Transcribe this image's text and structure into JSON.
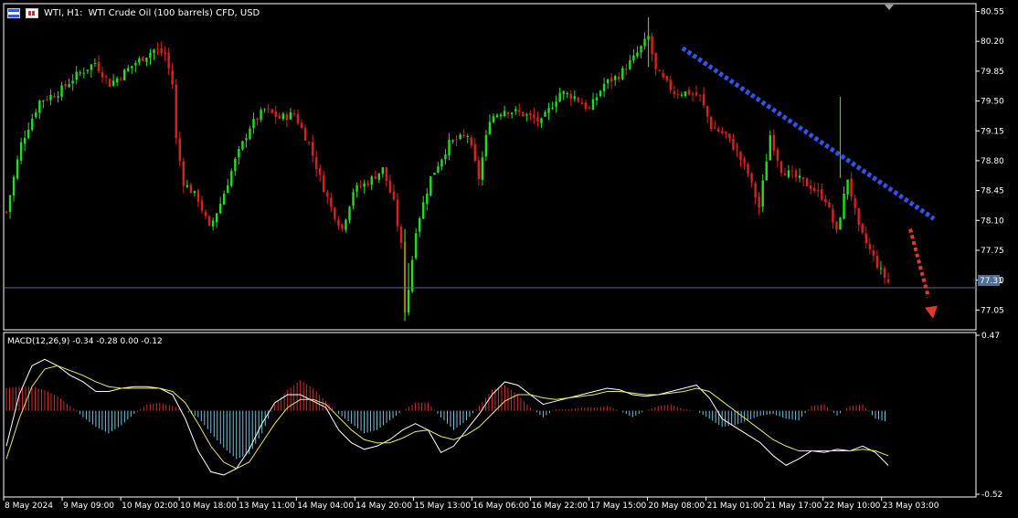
{
  "header": {
    "symbol": "WTI, H1:",
    "description": "WTI Crude Oil (100 barrels) CFD, USD"
  },
  "macd_label": "MACD(12,26,9) -0.34 -0.28 0.00 -0.12",
  "current_price_label": "77.31",
  "colors": {
    "bull": "#22dd22",
    "bear": "#dd1f1f",
    "macd_hist_pos": "#d42a2a",
    "macd_hist_neg": "#6fc6de",
    "signal": "#e8e868",
    "trendline": "#3355ee",
    "forecast_arrow": "#e0392f",
    "price_line": "#4e6f93"
  },
  "chart_data": [
    {
      "type": "candlestick",
      "title": "WTI, H1: WTI Crude Oil (100 barrels) CFD, USD",
      "ylim": [
        76.85,
        80.62
      ],
      "y_ticks": [
        "80.55",
        "80.20",
        "79.85",
        "79.50",
        "79.15",
        "78.80",
        "78.45",
        "78.10",
        "77.75",
        "77.40",
        "77.05"
      ],
      "x_ticks": [
        "8 May 2024",
        "9 May 09:00",
        "10 May 02:00",
        "10 May 18:00",
        "13 May 11:00",
        "14 May 04:00",
        "14 May 20:00",
        "15 May 13:00",
        "16 May 06:00",
        "16 May 22:00",
        "17 May 15:00",
        "20 May 08:00",
        "21 May 01:00",
        "21 May 17:00",
        "22 May 10:00",
        "23 May 03:00"
      ],
      "close_path_approx": [
        [
          0,
          78.2
        ],
        [
          4,
          79.0
        ],
        [
          9,
          79.5
        ],
        [
          14,
          79.6
        ],
        [
          19,
          79.8
        ],
        [
          24,
          79.95
        ],
        [
          28,
          79.7
        ],
        [
          31,
          79.8
        ],
        [
          35,
          79.95
        ],
        [
          40,
          80.1
        ],
        [
          43,
          80.05
        ],
        [
          45,
          79.7
        ],
        [
          46,
          79.05
        ],
        [
          48,
          78.55
        ],
        [
          52,
          78.35
        ],
        [
          55,
          78.0
        ],
        [
          58,
          78.3
        ],
        [
          62,
          78.8
        ],
        [
          66,
          79.2
        ],
        [
          70,
          79.4
        ],
        [
          74,
          79.3
        ],
        [
          78,
          79.35
        ],
        [
          82,
          79.0
        ],
        [
          85,
          78.6
        ],
        [
          88,
          78.25
        ],
        [
          91,
          78.0
        ],
        [
          94,
          78.45
        ],
        [
          98,
          78.55
        ],
        [
          102,
          78.7
        ],
        [
          105,
          78.3
        ],
        [
          107,
          77.8
        ],
        [
          108,
          77.05
        ],
        [
          109,
          77.3
        ],
        [
          111,
          78.0
        ],
        [
          115,
          78.6
        ],
        [
          120,
          79.0
        ],
        [
          125,
          79.1
        ],
        [
          128,
          78.6
        ],
        [
          131,
          79.3
        ],
        [
          135,
          79.4
        ],
        [
          140,
          79.35
        ],
        [
          145,
          79.25
        ],
        [
          150,
          79.6
        ],
        [
          154,
          79.55
        ],
        [
          158,
          79.4
        ],
        [
          162,
          79.7
        ],
        [
          166,
          79.8
        ],
        [
          170,
          80.0
        ],
        [
          174,
          80.25
        ],
        [
          176,
          79.85
        ],
        [
          178,
          79.75
        ],
        [
          181,
          79.6
        ],
        [
          185,
          79.6
        ],
        [
          188,
          79.55
        ],
        [
          191,
          79.2
        ],
        [
          195,
          79.1
        ],
        [
          198,
          78.9
        ],
        [
          201,
          78.65
        ],
        [
          204,
          78.25
        ],
        [
          207,
          79.1
        ],
        [
          210,
          78.7
        ],
        [
          214,
          78.6
        ],
        [
          218,
          78.5
        ],
        [
          222,
          78.35
        ],
        [
          225,
          77.95
        ],
        [
          228,
          78.6
        ],
        [
          231,
          78.0
        ],
        [
          234,
          77.75
        ],
        [
          237,
          77.5
        ],
        [
          240,
          77.31
        ]
      ],
      "current_price": 77.31,
      "annotations": [
        "descending trendline (dotted blue)",
        "downward forecast arrow (dotted red)"
      ]
    },
    {
      "type": "macd",
      "title": "MACD(12,26,9) -0.34 -0.28 0.00 -0.12",
      "ylim": [
        -0.52,
        0.47
      ],
      "y_ticks": [
        "0.47",
        "-0.52"
      ],
      "histogram": [
        0.14,
        0.15,
        0.15,
        0.13,
        0.09,
        0.03,
        -0.04,
        -0.1,
        -0.14,
        -0.09,
        -0.02,
        0.04,
        0.05,
        0.03,
        0.0,
        -0.04,
        -0.14,
        -0.23,
        -0.3,
        -0.27,
        -0.14,
        0.04,
        0.13,
        0.19,
        0.14,
        0.06,
        -0.02,
        -0.08,
        -0.14,
        -0.12,
        -0.06,
        0.0,
        0.05,
        0.05,
        -0.04,
        -0.12,
        -0.06,
        0.03,
        0.13,
        0.16,
        0.1,
        0.02,
        -0.04,
        0.01,
        0.01,
        0.02,
        0.02,
        0.03,
        0.0,
        -0.04,
        0.0,
        0.03,
        0.04,
        0.01,
        0.0,
        -0.05,
        -0.1,
        -0.09,
        -0.06,
        -0.03,
        -0.02,
        -0.05,
        -0.06,
        0.03,
        0.04,
        -0.03,
        0.03,
        0.04,
        -0.05,
        -0.07
      ],
      "macd_line": [
        -0.22,
        0.1,
        0.28,
        0.32,
        0.28,
        0.22,
        0.18,
        0.12,
        0.12,
        0.14,
        0.15,
        0.15,
        0.14,
        0.1,
        -0.05,
        -0.25,
        -0.38,
        -0.4,
        -0.36,
        -0.24,
        -0.08,
        0.05,
        0.1,
        0.1,
        0.06,
        0.02,
        -0.12,
        -0.2,
        -0.24,
        -0.22,
        -0.18,
        -0.12,
        -0.08,
        -0.12,
        -0.26,
        -0.22,
        -0.12,
        -0.02,
        0.1,
        0.18,
        0.16,
        0.1,
        0.04,
        0.06,
        0.08,
        0.1,
        0.12,
        0.14,
        0.13,
        0.1,
        0.09,
        0.1,
        0.12,
        0.14,
        0.16,
        0.08,
        -0.05,
        -0.1,
        -0.15,
        -0.2,
        -0.28,
        -0.34,
        -0.3,
        -0.25,
        -0.26,
        -0.24,
        -0.25,
        -0.22,
        -0.26,
        -0.34
      ],
      "signal_line": [
        -0.3,
        -0.05,
        0.15,
        0.26,
        0.28,
        0.25,
        0.22,
        0.18,
        0.15,
        0.14,
        0.14,
        0.14,
        0.14,
        0.12,
        0.05,
        -0.08,
        -0.22,
        -0.32,
        -0.36,
        -0.32,
        -0.2,
        -0.08,
        0.02,
        0.07,
        0.07,
        0.04,
        -0.04,
        -0.12,
        -0.18,
        -0.2,
        -0.2,
        -0.17,
        -0.13,
        -0.12,
        -0.16,
        -0.18,
        -0.15,
        -0.1,
        -0.02,
        0.06,
        0.1,
        0.1,
        0.08,
        0.07,
        0.08,
        0.09,
        0.1,
        0.12,
        0.12,
        0.11,
        0.1,
        0.1,
        0.11,
        0.12,
        0.14,
        0.12,
        0.06,
        0.0,
        -0.06,
        -0.12,
        -0.18,
        -0.22,
        -0.25,
        -0.25,
        -0.25,
        -0.25,
        -0.25,
        -0.24,
        -0.25,
        -0.28
      ]
    }
  ]
}
